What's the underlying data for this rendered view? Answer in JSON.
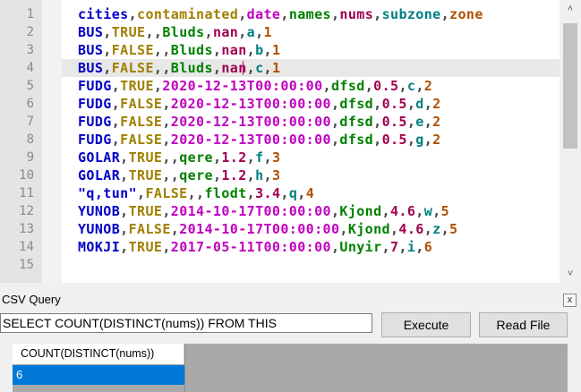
{
  "editor": {
    "line_numbers": [
      "1",
      "2",
      "3",
      "4",
      "5",
      "6",
      "7",
      "8",
      "9",
      "10",
      "11",
      "12",
      "13",
      "14",
      "15"
    ],
    "lines": [
      [
        [
          "cities",
          0
        ],
        [
          ",",
          9
        ],
        [
          "contaminated",
          1
        ],
        [
          ",",
          9
        ],
        [
          "date",
          2
        ],
        [
          ",",
          9
        ],
        [
          "names",
          3
        ],
        [
          ",",
          9
        ],
        [
          "nums",
          4
        ],
        [
          ",",
          9
        ],
        [
          "subzone",
          5
        ],
        [
          ",",
          9
        ],
        [
          "zone",
          6
        ]
      ],
      [
        [
          "BUS",
          0
        ],
        [
          ",",
          9
        ],
        [
          "TRUE",
          1
        ],
        [
          ",",
          9
        ],
        [
          "",
          2
        ],
        [
          ",",
          9
        ],
        [
          "Bluds",
          3
        ],
        [
          ",",
          9
        ],
        [
          "nan",
          4
        ],
        [
          ",",
          9
        ],
        [
          "a",
          5
        ],
        [
          ",",
          9
        ],
        [
          "1",
          6
        ]
      ],
      [
        [
          "BUS",
          0
        ],
        [
          ",",
          9
        ],
        [
          "FALSE",
          1
        ],
        [
          ",",
          9
        ],
        [
          "",
          2
        ],
        [
          ",",
          9
        ],
        [
          "Bluds",
          3
        ],
        [
          ",",
          9
        ],
        [
          "nan",
          4
        ],
        [
          ",",
          9
        ],
        [
          "b",
          5
        ],
        [
          ",",
          9
        ],
        [
          "1",
          6
        ]
      ],
      [
        [
          "BUS",
          0
        ],
        [
          ",",
          9
        ],
        [
          "FALSE",
          1
        ],
        [
          ",",
          9
        ],
        [
          "",
          2
        ],
        [
          ",",
          9
        ],
        [
          "Bluds",
          3
        ],
        [
          ",",
          9
        ],
        [
          "nan",
          4
        ],
        [
          ",",
          9
        ],
        [
          "c",
          5
        ],
        [
          ",",
          9
        ],
        [
          "1",
          6
        ]
      ],
      [
        [
          "FUDG",
          0
        ],
        [
          ",",
          9
        ],
        [
          "TRUE",
          1
        ],
        [
          ",",
          9
        ],
        [
          "2020-12-13T00:00:00",
          2
        ],
        [
          ",",
          9
        ],
        [
          "dfsd",
          3
        ],
        [
          ",",
          9
        ],
        [
          "0.5",
          4
        ],
        [
          ",",
          9
        ],
        [
          "c",
          5
        ],
        [
          ",",
          9
        ],
        [
          "2",
          6
        ]
      ],
      [
        [
          "FUDG",
          0
        ],
        [
          ",",
          9
        ],
        [
          "FALSE",
          1
        ],
        [
          ",",
          9
        ],
        [
          "2020-12-13T00:00:00",
          2
        ],
        [
          ",",
          9
        ],
        [
          "dfsd",
          3
        ],
        [
          ",",
          9
        ],
        [
          "0.5",
          4
        ],
        [
          ",",
          9
        ],
        [
          "d",
          5
        ],
        [
          ",",
          9
        ],
        [
          "2",
          6
        ]
      ],
      [
        [
          "FUDG",
          0
        ],
        [
          ",",
          9
        ],
        [
          "FALSE",
          1
        ],
        [
          ",",
          9
        ],
        [
          "2020-12-13T00:00:00",
          2
        ],
        [
          ",",
          9
        ],
        [
          "dfsd",
          3
        ],
        [
          ",",
          9
        ],
        [
          "0.5",
          4
        ],
        [
          ",",
          9
        ],
        [
          "e",
          5
        ],
        [
          ",",
          9
        ],
        [
          "2",
          6
        ]
      ],
      [
        [
          "FUDG",
          0
        ],
        [
          ",",
          9
        ],
        [
          "FALSE",
          1
        ],
        [
          ",",
          9
        ],
        [
          "2020-12-13T00:00:00",
          2
        ],
        [
          ",",
          9
        ],
        [
          "dfsd",
          3
        ],
        [
          ",",
          9
        ],
        [
          "0.5",
          4
        ],
        [
          ",",
          9
        ],
        [
          "g",
          5
        ],
        [
          ",",
          9
        ],
        [
          "2",
          6
        ]
      ],
      [
        [
          "GOLAR",
          0
        ],
        [
          ",",
          9
        ],
        [
          "TRUE",
          1
        ],
        [
          ",",
          9
        ],
        [
          "",
          2
        ],
        [
          ",",
          9
        ],
        [
          "qere",
          3
        ],
        [
          ",",
          9
        ],
        [
          "1.2",
          4
        ],
        [
          ",",
          9
        ],
        [
          "f",
          5
        ],
        [
          ",",
          9
        ],
        [
          "3",
          6
        ]
      ],
      [
        [
          "GOLAR",
          0
        ],
        [
          ",",
          9
        ],
        [
          "TRUE",
          1
        ],
        [
          ",",
          9
        ],
        [
          "",
          2
        ],
        [
          ",",
          9
        ],
        [
          "qere",
          3
        ],
        [
          ",",
          9
        ],
        [
          "1.2",
          4
        ],
        [
          ",",
          9
        ],
        [
          "h",
          5
        ],
        [
          ",",
          9
        ],
        [
          "3",
          6
        ]
      ],
      [
        [
          "\"q,tun\"",
          0
        ],
        [
          ",",
          9
        ],
        [
          "FALSE",
          1
        ],
        [
          ",",
          9
        ],
        [
          "",
          2
        ],
        [
          ",",
          9
        ],
        [
          "flodt",
          3
        ],
        [
          ",",
          9
        ],
        [
          "3.4",
          4
        ],
        [
          ",",
          9
        ],
        [
          "q",
          5
        ],
        [
          ",",
          9
        ],
        [
          "4",
          6
        ]
      ],
      [
        [
          "YUNOB",
          0
        ],
        [
          ",",
          9
        ],
        [
          "TRUE",
          1
        ],
        [
          ",",
          9
        ],
        [
          "2014-10-17T00:00:00",
          2
        ],
        [
          ",",
          9
        ],
        [
          "Kjond",
          3
        ],
        [
          ",",
          9
        ],
        [
          "4.6",
          4
        ],
        [
          ",",
          9
        ],
        [
          "w",
          5
        ],
        [
          ",",
          9
        ],
        [
          "5",
          6
        ]
      ],
      [
        [
          "YUNOB",
          0
        ],
        [
          ",",
          9
        ],
        [
          "FALSE",
          1
        ],
        [
          ",",
          9
        ],
        [
          "2014-10-17T00:00:00",
          2
        ],
        [
          ",",
          9
        ],
        [
          "Kjond",
          3
        ],
        [
          ",",
          9
        ],
        [
          "4.6",
          4
        ],
        [
          ",",
          9
        ],
        [
          "z",
          5
        ],
        [
          ",",
          9
        ],
        [
          "5",
          6
        ]
      ],
      [
        [
          "MOKJI",
          0
        ],
        [
          ",",
          9
        ],
        [
          "TRUE",
          1
        ],
        [
          ",",
          9
        ],
        [
          "2017-05-11T00:00:00",
          2
        ],
        [
          ",",
          9
        ],
        [
          "Unyir",
          3
        ],
        [
          ",",
          9
        ],
        [
          "7",
          4
        ],
        [
          ",",
          9
        ],
        [
          "i",
          5
        ],
        [
          ",",
          9
        ],
        [
          "6",
          6
        ]
      ],
      []
    ],
    "column_colors": [
      "#0000c8",
      "#a08000",
      "#c000c0",
      "#008000",
      "#a00050",
      "#008080",
      "#b05000"
    ],
    "comma_color": "#444444",
    "current_line_index": 3
  },
  "scrollbar": {
    "up_icon": "chevron-up-icon",
    "down_icon": "chevron-down-icon"
  },
  "panel": {
    "title": "CSV Query",
    "close_icon": "close-icon",
    "close_glyph": "x"
  },
  "query": {
    "input_value": "SELECT COUNT(DISTINCT(nums)) FROM THIS",
    "execute_label": "Execute",
    "read_file_label": "Read File"
  },
  "results": {
    "columns": [
      "COUNT(DISTINCT(nums))"
    ],
    "rows": [
      [
        "6"
      ]
    ]
  },
  "colors": {
    "selection": "#0078d7",
    "grid_background": "#a9a9a9"
  }
}
